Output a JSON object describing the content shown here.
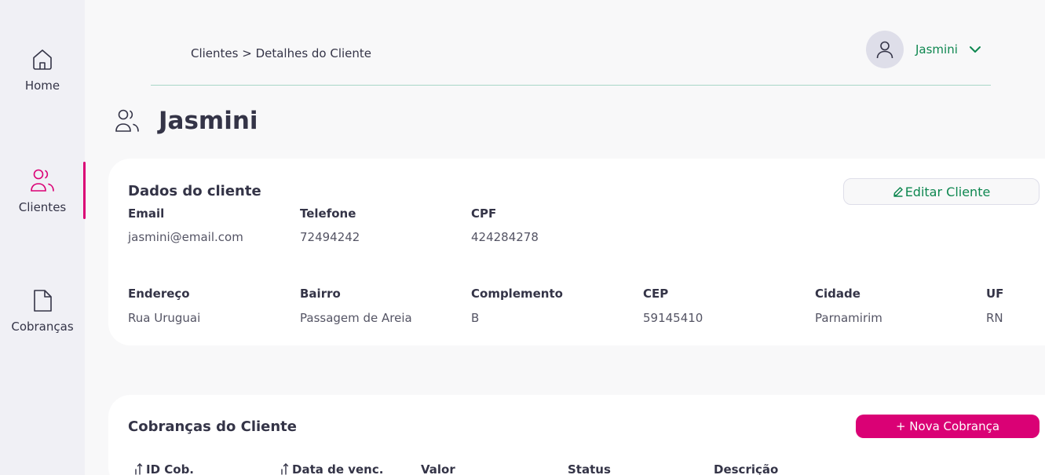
{
  "sidebar": {
    "items": [
      {
        "label": "Home",
        "icon": "home-icon"
      },
      {
        "label": "Clientes",
        "icon": "users-icon"
      },
      {
        "label": "Cobranças",
        "icon": "document-icon"
      }
    ],
    "active_index": 1
  },
  "header": {
    "breadcrumb": "Clientes > Detalhes do Cliente",
    "user_name": "Jasmini"
  },
  "page": {
    "title": "Jasmini"
  },
  "client_card": {
    "title": "Dados do cliente",
    "edit_label": "Editar Cliente",
    "fields_top": [
      {
        "label": "Email",
        "value": "jasmini@email.com"
      },
      {
        "label": "Telefone",
        "value": "72494242"
      },
      {
        "label": "CPF",
        "value": "424284278"
      }
    ],
    "fields_bottom": [
      {
        "label": "Endereço",
        "value": "Rua Uruguai"
      },
      {
        "label": "Bairro",
        "value": "Passagem de Areia"
      },
      {
        "label": "Complemento",
        "value": "B"
      },
      {
        "label": "CEP",
        "value": "59145410"
      },
      {
        "label": "Cidade",
        "value": "Parnamirim"
      },
      {
        "label": "UF",
        "value": "RN"
      }
    ]
  },
  "charges_card": {
    "title": "Cobranças do Cliente",
    "new_label": "+ Nova Cobrança",
    "columns": [
      "ID Cob.",
      "Data de venc.",
      "Valor",
      "Status",
      "Descrição"
    ]
  },
  "colors": {
    "accent_pink": "#da0175",
    "accent_green": "#0e8750",
    "sidebar_bg": "#f0f0f5",
    "page_bg": "#f8f8f9"
  }
}
